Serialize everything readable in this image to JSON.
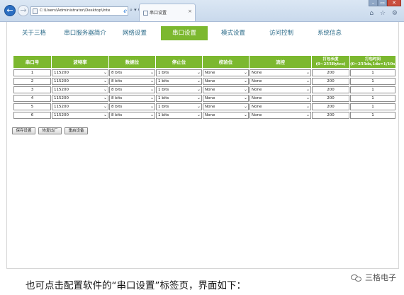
{
  "browser": {
    "address": "C:\\Users\\Administrator\\Desktop\\Inte",
    "address_tools": "⌕ ▾ C",
    "tab_title": "串口设置",
    "tab_close": "×",
    "win_min": "–",
    "win_max": "▭",
    "win_close": "✕",
    "right_icons": "⌂ ☆ ⚙"
  },
  "nav": {
    "items": [
      {
        "label": "关于三格",
        "active": false
      },
      {
        "label": "串口服务器简介",
        "active": false
      },
      {
        "label": "网络设置",
        "active": false
      },
      {
        "label": "串口设置",
        "active": true
      },
      {
        "label": "模式设置",
        "active": false
      },
      {
        "label": "访问控制",
        "active": false
      },
      {
        "label": "系统信息",
        "active": false
      }
    ]
  },
  "table": {
    "headers": [
      "串口号",
      "波特率",
      "数据位",
      "停止位",
      "校验位",
      "流控",
      "打包长度\n(0~255Bytes)",
      "打包时间\n(0~255ds,1ds=1/10s)"
    ],
    "rows": [
      {
        "port": "1",
        "baud": "115200",
        "data_bits": "8 bits",
        "stop_bits": "1 bits",
        "parity": "None",
        "flow": "None",
        "pack_len": "200",
        "pack_time": "1"
      },
      {
        "port": "2",
        "baud": "115200",
        "data_bits": "8 bits",
        "stop_bits": "1 bits",
        "parity": "None",
        "flow": "None",
        "pack_len": "200",
        "pack_time": "1"
      },
      {
        "port": "3",
        "baud": "115200",
        "data_bits": "8 bits",
        "stop_bits": "1 bits",
        "parity": "None",
        "flow": "None",
        "pack_len": "200",
        "pack_time": "1"
      },
      {
        "port": "4",
        "baud": "115200",
        "data_bits": "8 bits",
        "stop_bits": "1 bits",
        "parity": "None",
        "flow": "None",
        "pack_len": "200",
        "pack_time": "1"
      },
      {
        "port": "5",
        "baud": "115200",
        "data_bits": "8 bits",
        "stop_bits": "1 bits",
        "parity": "None",
        "flow": "None",
        "pack_len": "200",
        "pack_time": "1"
      },
      {
        "port": "6",
        "baud": "115200",
        "data_bits": "8 bits",
        "stop_bits": "1 bits",
        "parity": "None",
        "flow": "None",
        "pack_len": "200",
        "pack_time": "1"
      }
    ]
  },
  "buttons": {
    "save": "保存设置",
    "restore": "恢复出厂",
    "reboot": "重启设备"
  },
  "caption": "也可点击配置软件的“串口设置”标签页，界面如下：",
  "watermark": "三格电子",
  "colors": {
    "accent": "#7cb82f",
    "nav_text": "#2d6c8a"
  }
}
